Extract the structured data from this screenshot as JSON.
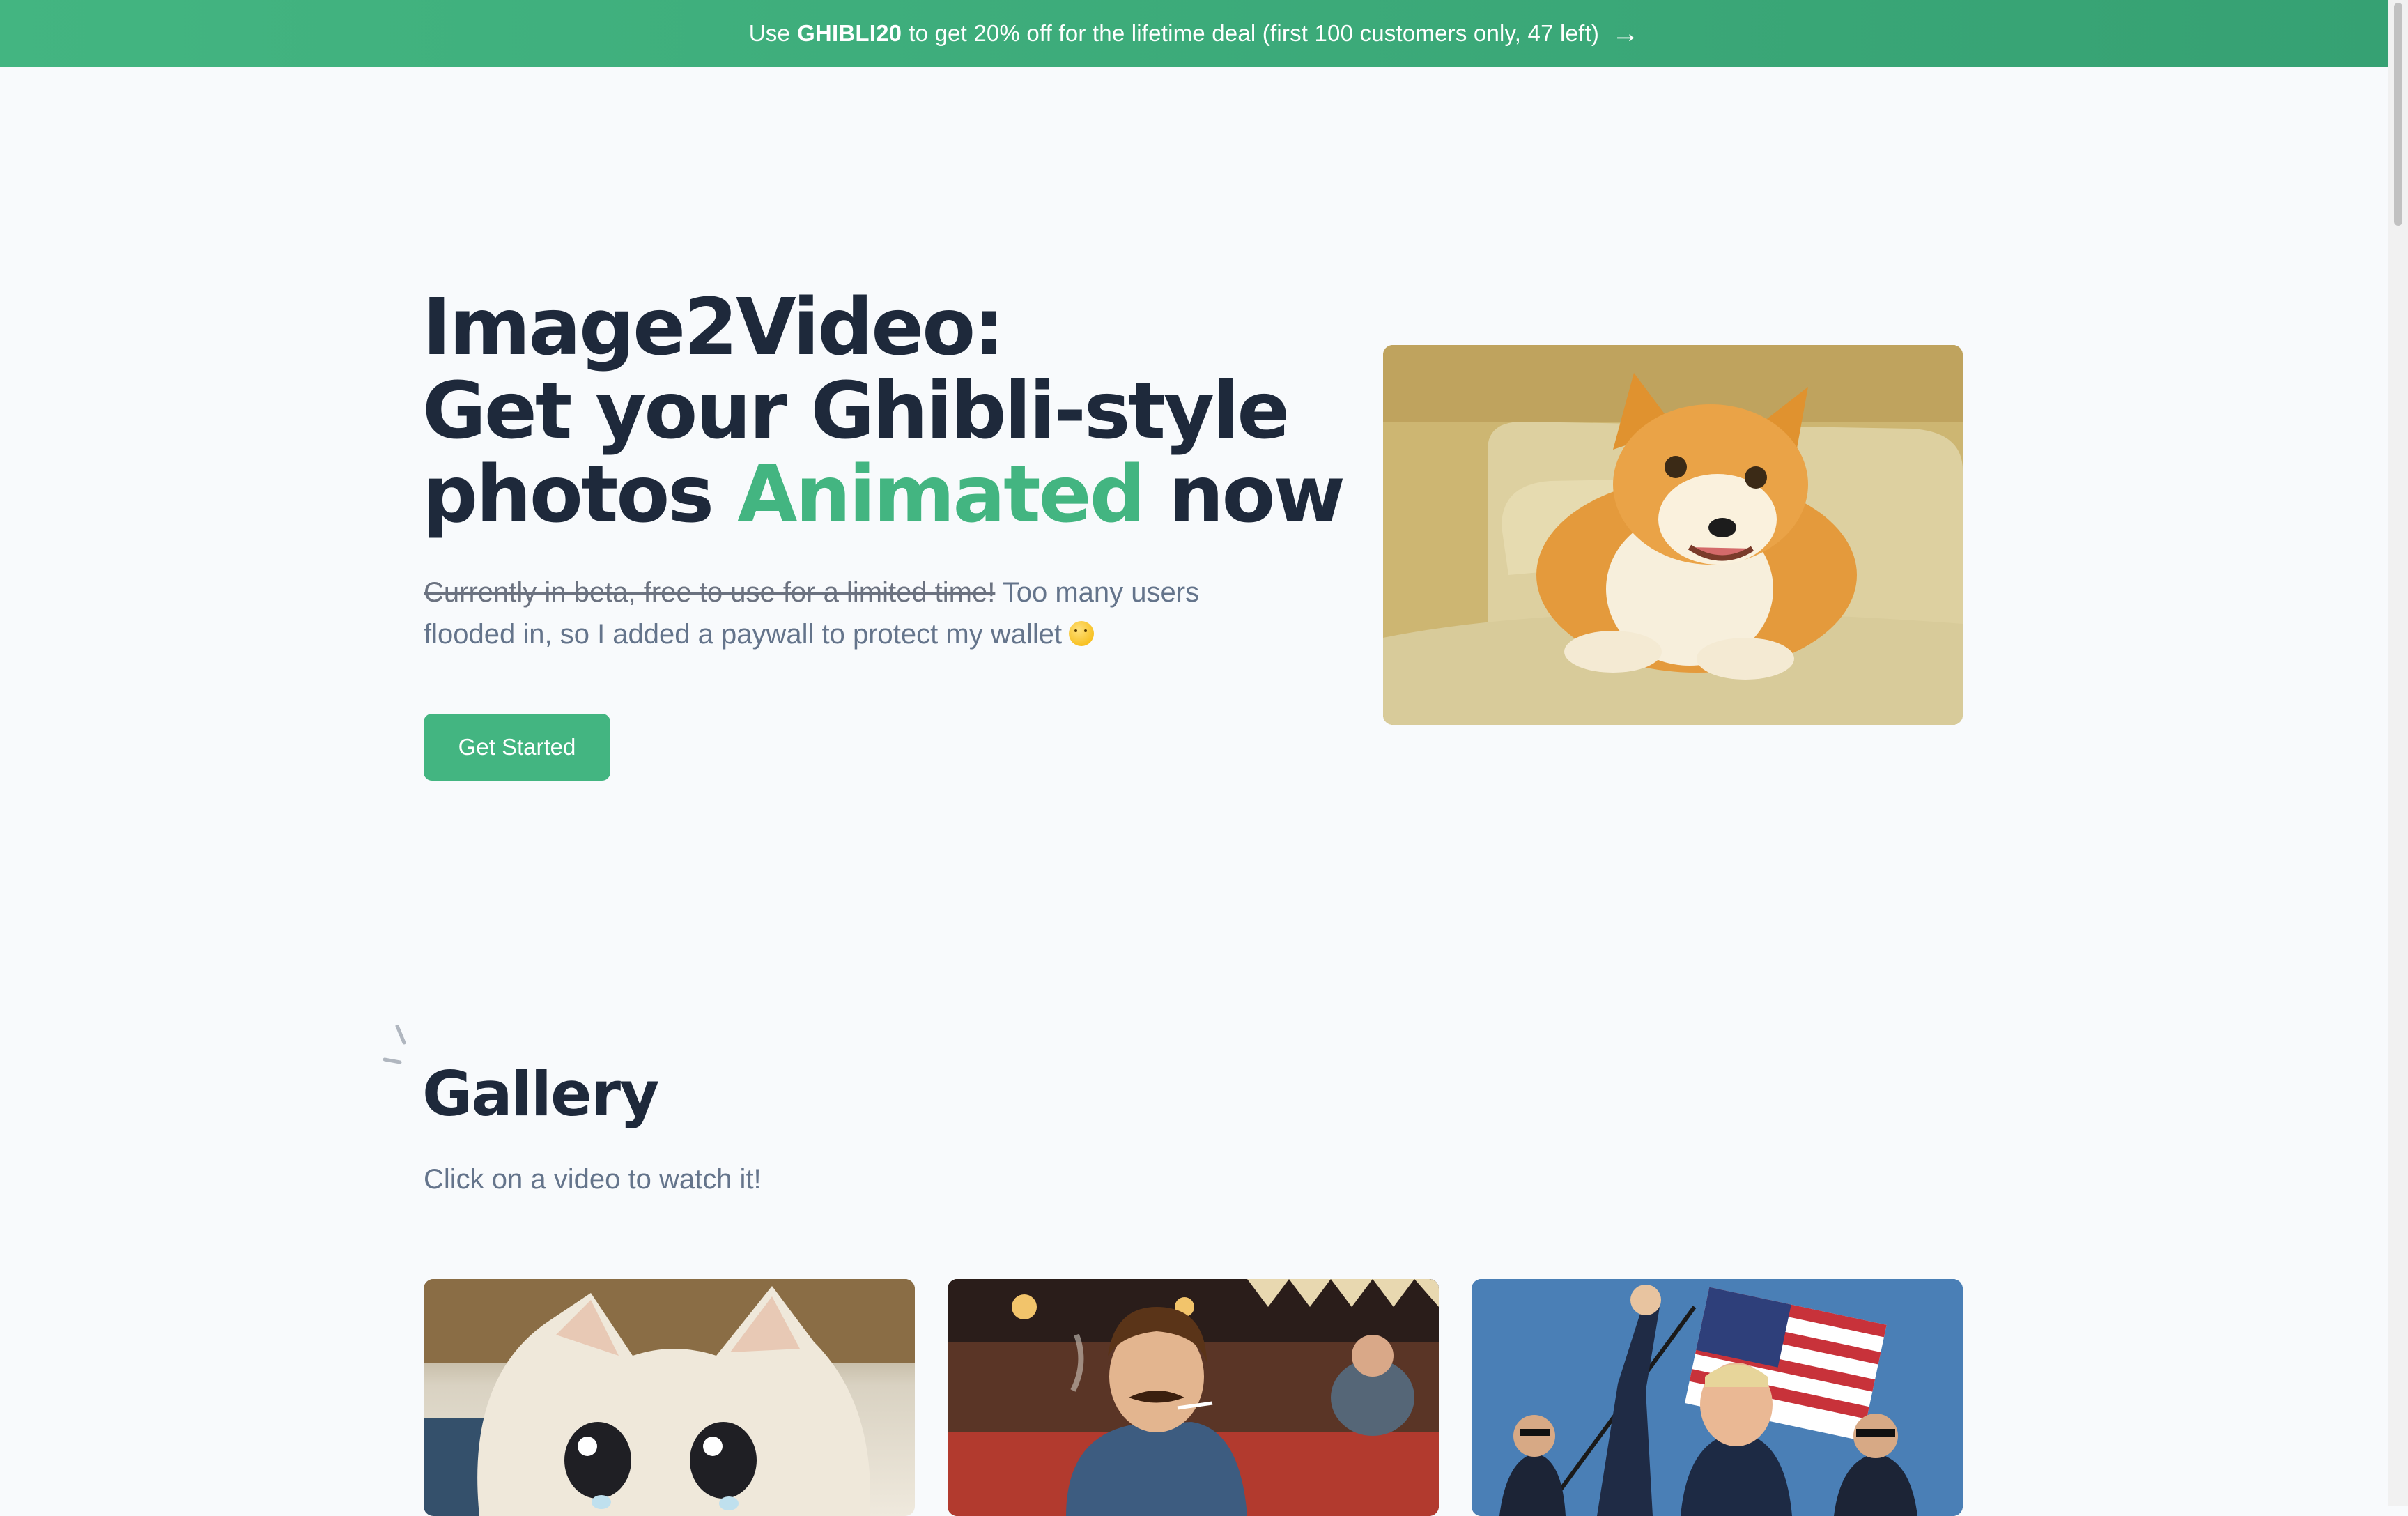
{
  "banner": {
    "prefix": "Use",
    "code": "GHIBLI20",
    "suffix": "to get 20% off for the lifetime deal (first 100 customers only, 47 left)",
    "arrow": "→"
  },
  "hero": {
    "title_line1": "Image2Video:",
    "title_line2": "Get your Ghibli-style",
    "title_line3_before": "photos",
    "title_line3_accent": "Animated",
    "title_line3_after": "now",
    "subtitle_struck": "Currently in beta, free to use for a limited time!",
    "subtitle_rest": "Too many users flooded in, so I added a paywall to protect my wallet",
    "emoji_icon": "crying-face-emoji",
    "cta_label": "Get Started",
    "image_icon": "shiba-dog-on-couch-image"
  },
  "gallery": {
    "title": "Gallery",
    "subtitle": "Click on a video to watch it!",
    "videos": [
      {
        "icon": "crying-cat-video-thumbnail"
      },
      {
        "icon": "mustache-man-diner-video-thumbnail"
      },
      {
        "icon": "flag-crowd-video-thumbnail"
      }
    ]
  },
  "colors": {
    "accent": "#43b581",
    "banner_end": "#36a173",
    "heading": "#1e293b",
    "body_text": "#64748b",
    "background": "#f8fafc"
  }
}
